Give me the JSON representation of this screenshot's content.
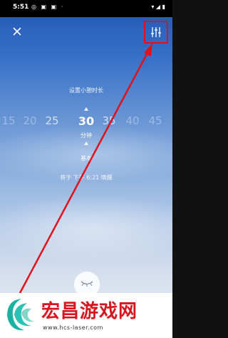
{
  "status_bar": {
    "time": "5:51",
    "left_icons": "◎ ▣ ▣ ·",
    "right_icons": "▾ ◢ ▮"
  },
  "header": {
    "close_icon": "close-icon",
    "settings_icon": "sliders-icon"
  },
  "timer": {
    "title": "设置小憩时长",
    "values": [
      "15",
      "20",
      "25",
      "30",
      "35",
      "40",
      "45"
    ],
    "selected": "30",
    "unit": "分钟",
    "mode_label": "基本",
    "wake_label": "将于 下午 6:21 唤醒"
  },
  "footer": {
    "sleep_icon": "closed-eye-icon"
  },
  "annotation": {
    "color": "#e0111b"
  },
  "watermark": {
    "name": "宏昌游戏网",
    "url": "www.hcs-laser.com"
  }
}
